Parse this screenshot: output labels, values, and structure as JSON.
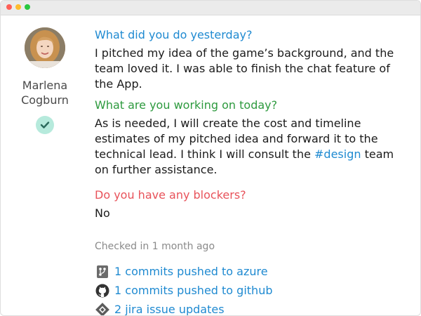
{
  "user": {
    "first_name": "Marlena",
    "last_name": "Cogburn"
  },
  "standup": {
    "yesterday_question": "What did you do yesterday?",
    "yesterday_answer": "I pitched my idea of the game’s background, and the team loved it. I was able to finish the chat feature of the App.",
    "today_question": "What are you working on today?",
    "today_answer_part1": "As is needed, I will create the cost and timeline estimates of my pitched idea and forward it to the technical lead. I think I will consult the ",
    "today_answer_tag": "#design",
    "today_answer_part2": " team on further assistance.",
    "blockers_question": "Do you have any blockers?",
    "blockers_answer": "No"
  },
  "checked_in": "Checked in 1 month ago",
  "activity": [
    {
      "icon": "azure-repo-icon",
      "label": "1 commits pushed to azure"
    },
    {
      "icon": "github-icon",
      "label": "1 commits pushed to github"
    },
    {
      "icon": "jira-icon",
      "label": "2 jira issue updates"
    }
  ],
  "colors": {
    "question_blue": "#1f8ad1",
    "question_green": "#2d9a3e",
    "question_red": "#e8525a",
    "check_badge": "#b6eadc"
  }
}
